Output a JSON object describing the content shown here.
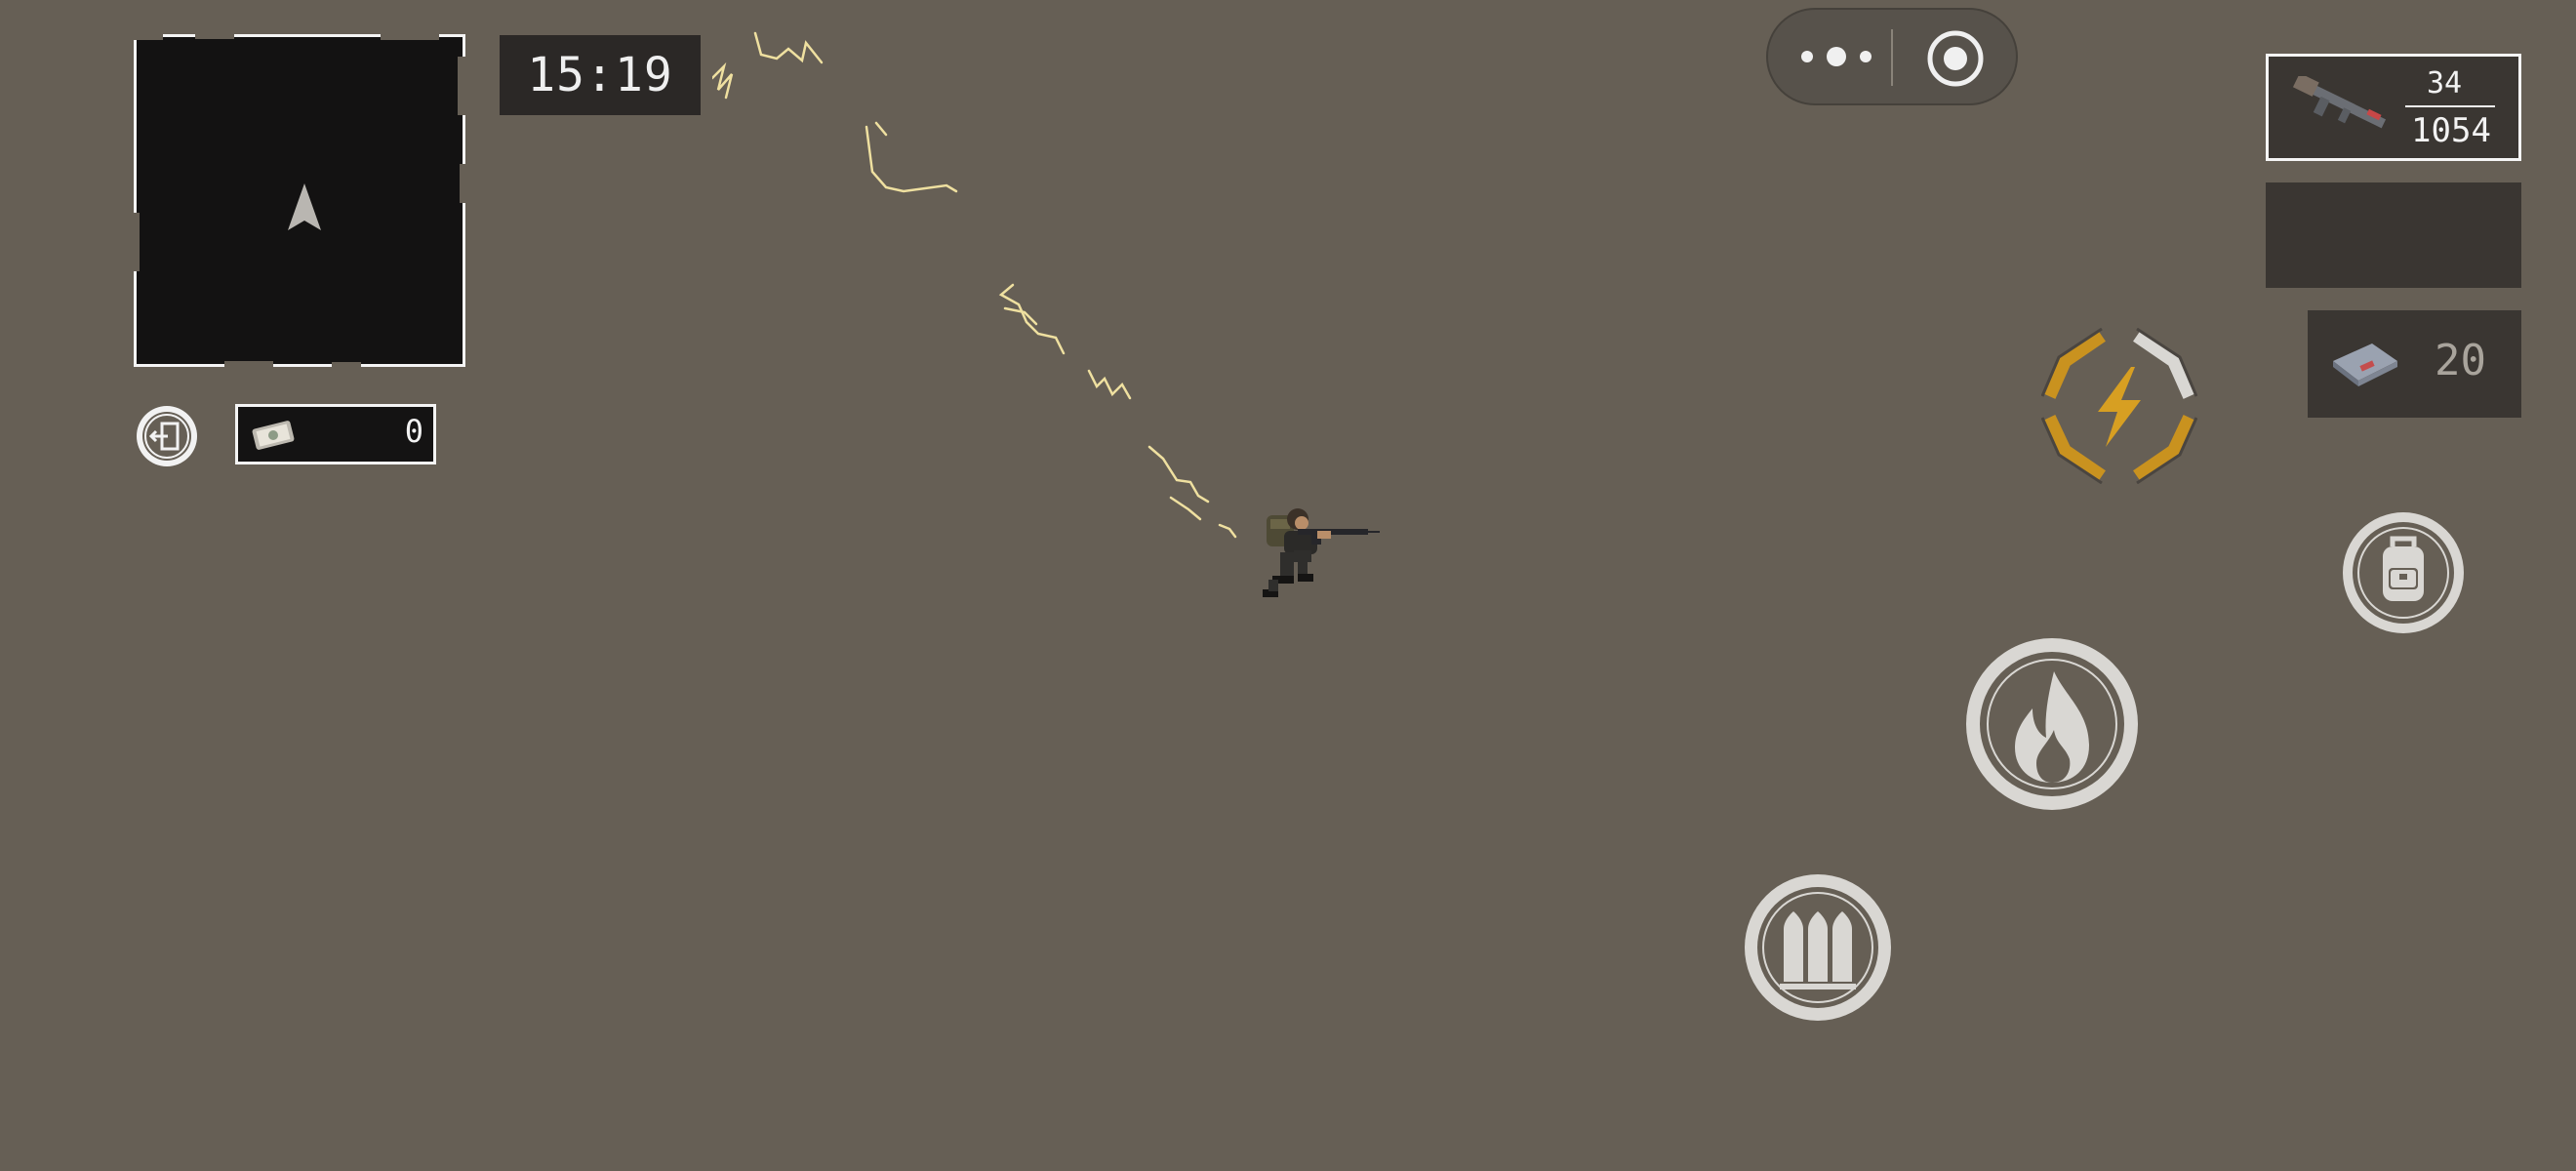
{
  "hud": {
    "timer": "15:19",
    "cash": "0",
    "weapon": {
      "magazine_ammo": "34",
      "reserve_ammo": "1054",
      "icon": "assault-rifle-icon"
    },
    "item": {
      "count": "20",
      "icon": "ammo-pack-icon"
    }
  },
  "buttons": {
    "menu": "more-dots-icon",
    "close": "target-circle-icon",
    "exit": "exit-door-icon",
    "skill": "lightning-icon",
    "backpack": "backpack-icon",
    "fire": "flame-icon",
    "reload": "bullets-icon"
  },
  "colors": {
    "background": "#665f55",
    "panel": "#3a3632",
    "minimap": "#131212",
    "accent_gold": "#c9921f",
    "bullet_trail": "#efe0a0",
    "button_ring": "#d9d7d3"
  }
}
